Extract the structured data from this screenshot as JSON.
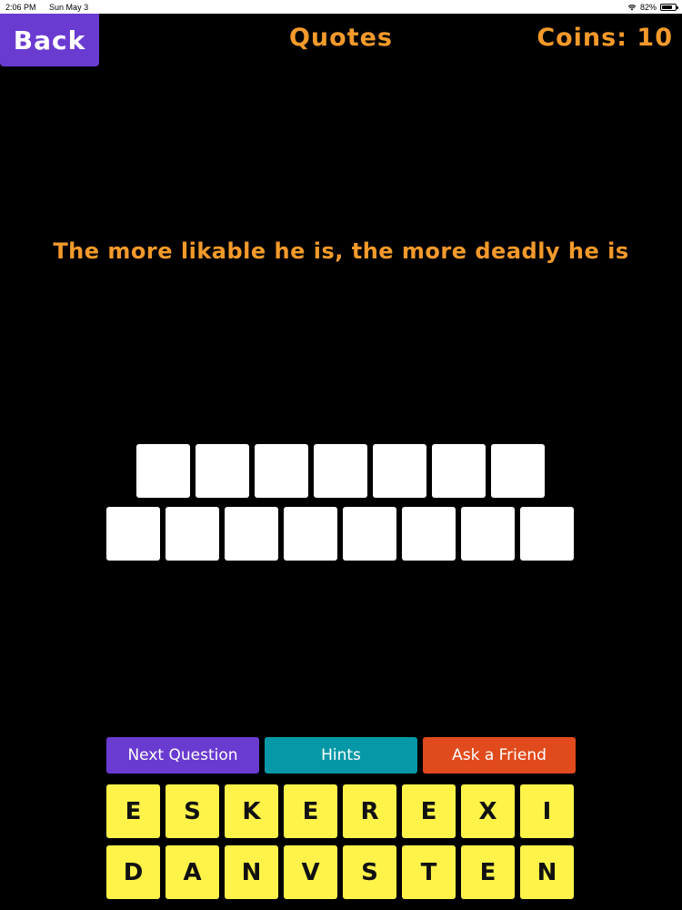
{
  "status_bar": {
    "time": "2:06 PM",
    "date": "Sun May 3",
    "battery": "82%",
    "battery_level": 0.82,
    "wifi_icon": "wifi-icon",
    "battery_icon": "battery-icon"
  },
  "header": {
    "back_label": "Back",
    "title": "Quotes",
    "coins": "Coins: 10"
  },
  "quote": {
    "text": "The more likable he is, the more deadly he is"
  },
  "answer": {
    "row1": [
      "",
      "",
      "",
      "",
      "",
      "",
      ""
    ],
    "row2": [
      "",
      "",
      "",
      "",
      "",
      "",
      "",
      ""
    ]
  },
  "actions": {
    "next_label": "Next Question",
    "hints_label": "Hints",
    "friend_label": "Ask a Friend"
  },
  "keyboard": {
    "row1": [
      "E",
      "S",
      "K",
      "E",
      "R",
      "E",
      "X",
      "I"
    ],
    "row2": [
      "D",
      "A",
      "N",
      "V",
      "S",
      "T",
      "E",
      "N"
    ]
  },
  "colors": {
    "accent_orange": "#f39a2b",
    "purple": "#6a3bd0",
    "teal": "#0798a7",
    "red_orange": "#e14a1c",
    "key_yellow": "#fff34a"
  }
}
